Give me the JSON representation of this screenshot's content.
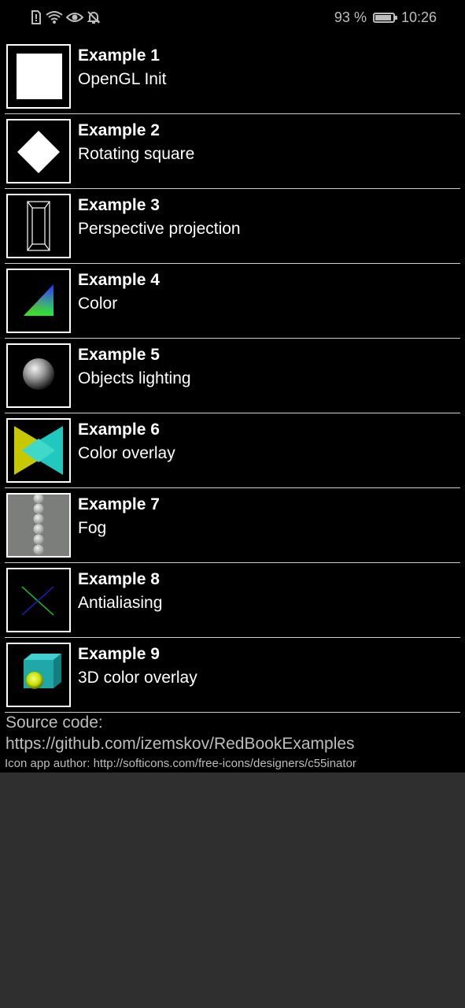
{
  "status_bar": {
    "icons": [
      "alert-icon",
      "wifi-icon",
      "eye-icon",
      "bell-off-icon"
    ],
    "battery": "93 %",
    "battery_level": 0.93,
    "time": "10:26"
  },
  "examples": [
    {
      "title": "Example 1",
      "subtitle": "OpenGL Init",
      "icon": "white-square-icon"
    },
    {
      "title": "Example 2",
      "subtitle": "Rotating square",
      "icon": "rotated-square-icon"
    },
    {
      "title": "Example 3",
      "subtitle": "Perspective projection",
      "icon": "wireframe-box-icon"
    },
    {
      "title": "Example 4",
      "subtitle": "Color",
      "icon": "color-triangle-icon"
    },
    {
      "title": "Example 5",
      "subtitle": "Objects lighting",
      "icon": "lit-sphere-icon"
    },
    {
      "title": "Example 6",
      "subtitle": "Color overlay",
      "icon": "overlay-triangles-icon"
    },
    {
      "title": "Example 7",
      "subtitle": "Fog",
      "icon": "fog-spheres-icon"
    },
    {
      "title": "Example 8",
      "subtitle": "Antialiasing",
      "icon": "antialias-lines-icon"
    },
    {
      "title": "Example 9",
      "subtitle": "3D color overlay",
      "icon": "cube-sphere-icon"
    }
  ],
  "footer": {
    "source_code": "Source code: https://github.com/izemskov/RedBookExamples",
    "icon_author": "Icon app author: http://softicons.com/free-icons/designers/c55inator"
  },
  "colors": {
    "background": "#000000",
    "lower_background": "#2f2f2f",
    "divider": "#cfcfcf",
    "muted_text": "#bdbdbd"
  }
}
